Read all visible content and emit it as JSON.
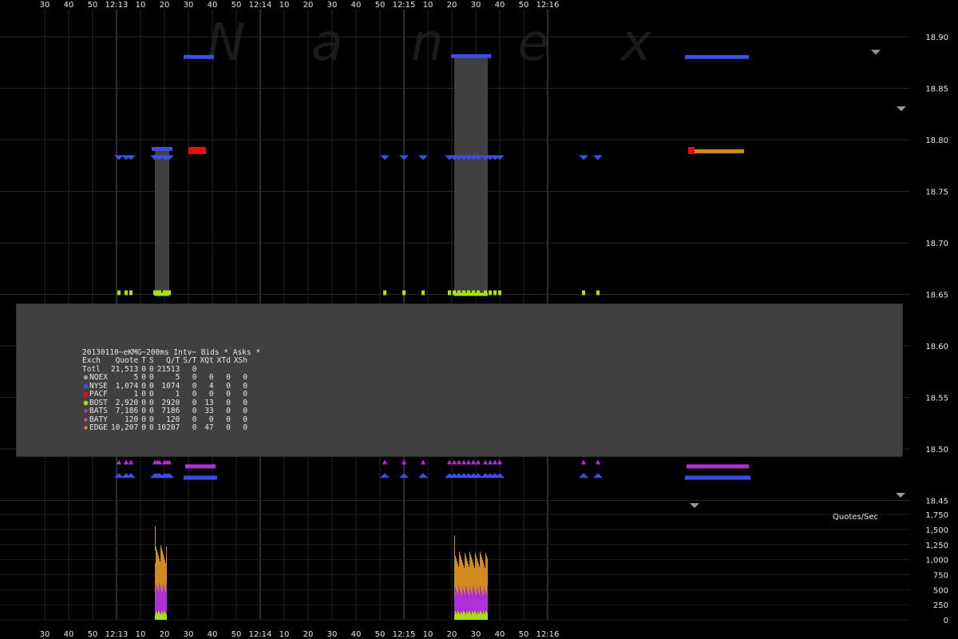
{
  "watermark": [
    "N",
    "a",
    "n",
    "e",
    "x"
  ],
  "chart_data": {
    "type": "scatter",
    "title": "20130110~eKMG~200ms Intv~ Bids * Asks *",
    "x_ticks_top": [
      "30",
      "40",
      "50",
      "12:13",
      "10",
      "20",
      "30",
      "40",
      "50",
      "12:14",
      "10",
      "20",
      "30",
      "40",
      "50",
      "12:15",
      "10",
      "20",
      "30",
      "40",
      "50",
      "12:16"
    ],
    "x_ticks_bottom": [
      "30",
      "40",
      "50",
      "12:13",
      "10",
      "20",
      "30",
      "40",
      "50",
      "12:14",
      "10",
      "20",
      "30",
      "40",
      "50",
      "12:15",
      "10",
      "20",
      "30",
      "40",
      "50",
      "12:16"
    ],
    "price_axis": {
      "ticks": [
        "18.90",
        "18.85",
        "18.80",
        "18.75",
        "18.70",
        "18.65",
        "18.60",
        "18.55",
        "18.50",
        "18.45"
      ],
      "ylim": [
        18.44,
        18.92
      ]
    },
    "quotes_axis": {
      "label": "Quotes/Sec",
      "ticks": [
        "1,750",
        "1,500",
        "1,250",
        "1,000",
        "750",
        "500",
        "250",
        "0"
      ],
      "ylim": [
        0,
        1750
      ]
    },
    "nbbo_bands": [
      {
        "t_start": "12:13:06",
        "t_end": "12:13:12",
        "bid": 18.65,
        "ask": 18.79
      },
      {
        "t_start": "12:15:11",
        "t_end": "12:15:25",
        "bid": 18.65,
        "ask": 18.88
      }
    ],
    "bursts": [
      {
        "t_start": "12:13:06",
        "t_end": "12:13:11",
        "total_peak": 1550,
        "edge": 1150,
        "bats": 550,
        "bost": 150
      },
      {
        "t_start": "12:15:11",
        "t_end": "12:15:25",
        "total_peak": 1400,
        "edge": 1050,
        "bats": 500,
        "bost": 150
      }
    ],
    "quote_events_seconds_from_12_12_20": [
      31,
      34,
      36,
      46,
      47,
      48,
      50,
      51,
      52,
      142,
      150,
      158,
      169,
      171,
      173,
      175,
      177,
      179,
      181,
      184,
      186,
      188,
      190,
      225,
      231
    ]
  },
  "legend": {
    "title": "20130110~eKMG~200ms Intv~ Bids * Asks *",
    "headers": [
      "Exch",
      "Quote",
      "T",
      "S",
      "Q/T",
      "S/T",
      "XQt",
      "XTd",
      "XSh"
    ],
    "total": {
      "exch": "Totl",
      "quote": "21,513",
      "t": "0",
      "s": "0",
      "qt": "21513",
      "st": "0",
      "xqt": "",
      "xtd": "",
      "xsh": ""
    },
    "rows": [
      {
        "exch": "NQEX",
        "color": "#9a9a9a",
        "symbol": "●",
        "quote": "5",
        "t": "0",
        "s": "0",
        "qt": "5",
        "st": "0",
        "xqt": "0",
        "xtd": "0",
        "xsh": "0"
      },
      {
        "exch": "NYSE",
        "color": "#3c4ee8",
        "symbol": "●",
        "quote": "1,074",
        "t": "0",
        "s": "0",
        "qt": "1074",
        "st": "0",
        "xqt": "4",
        "xtd": "0",
        "xsh": "0"
      },
      {
        "exch": "PACF",
        "color": "#e01010",
        "symbol": "■",
        "quote": "1",
        "t": "0",
        "s": "0",
        "qt": "1",
        "st": "0",
        "xqt": "0",
        "xtd": "0",
        "xsh": "0"
      },
      {
        "exch": "BOST",
        "color": "#a8e010",
        "symbol": "●",
        "quote": "2,920",
        "t": "0",
        "s": "0",
        "qt": "2920",
        "st": "0",
        "xqt": "13",
        "xtd": "0",
        "xsh": "0"
      },
      {
        "exch": "BATS",
        "color": "#b030d8",
        "symbol": "◆",
        "quote": "7,186",
        "t": "0",
        "s": "0",
        "qt": "7186",
        "st": "0",
        "xqt": "33",
        "xtd": "0",
        "xsh": "0"
      },
      {
        "exch": "BATY",
        "color": "#e040b0",
        "symbol": "◆",
        "quote": "120",
        "t": "0",
        "s": "0",
        "qt": "120",
        "st": "0",
        "xqt": "0",
        "xtd": "0",
        "xsh": "0"
      },
      {
        "exch": "EDGE",
        "color": "#d08a20",
        "symbol": "◆",
        "quote": "10,207",
        "t": "0",
        "s": "0",
        "qt": "10207",
        "st": "0",
        "xqt": "47",
        "xtd": "0",
        "xsh": "0"
      }
    ]
  },
  "colors": {
    "background": "#000000",
    "band": "#404040",
    "grid": "#2a2a2a",
    "nyse": "#3c4ee8",
    "bost": "#a8e010",
    "bats": "#b030d8",
    "edge": "#d08a20",
    "pacf": "#e01010",
    "nqex": "#9a9a9a"
  }
}
